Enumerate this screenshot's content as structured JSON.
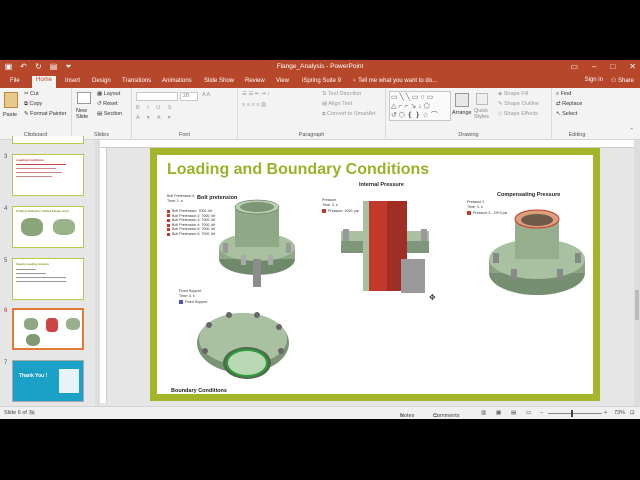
{
  "window": {
    "title": "Flange_Analysis - PowerPoint",
    "controls": [
      "–",
      "□",
      "✕"
    ]
  },
  "tabs": [
    "File",
    "Home",
    "Insert",
    "Design",
    "Transitions",
    "Animations",
    "Slide Show",
    "Review",
    "View",
    "iSpring Suite 9"
  ],
  "tell_me": "Tell me what you want to do...",
  "signin": "Sign in",
  "share": "Share",
  "ribbon": {
    "clipboard": {
      "paste": "Paste",
      "cut": "Cut",
      "copy": "Copy",
      "format_painter": "Format Painter",
      "label": "Clipboard"
    },
    "slides": {
      "new_slide": "New Slide",
      "layout": "Layout",
      "reset": "Reset",
      "section": "Section",
      "label": "Slides"
    },
    "font": {
      "label": "Font",
      "size": "28"
    },
    "paragraph": {
      "text_direction": "Text Direction",
      "align_text": "Align Text",
      "convert_smartart": "Convert to SmartArt",
      "label": "Paragraph"
    },
    "drawing": {
      "arrange": "Arrange",
      "quick_styles": "Quick Styles",
      "shape_fill": "Shape Fill",
      "shape_outline": "Shape Outline",
      "shape_effects": "Shape Effects",
      "label": "Drawing"
    },
    "editing": {
      "find": "Find",
      "replace": "Replace",
      "select": "Select",
      "label": "Editing"
    }
  },
  "thumbnails": [
    {
      "num": "3",
      "text": "Loading Conditions"
    },
    {
      "num": "4",
      "text": "Problem Definition: Bolted Flange Joint"
    },
    {
      "num": "5",
      "text": "Steady Loading Analysis"
    },
    {
      "num": "6",
      "text": ""
    },
    {
      "num": "7",
      "text": "Thank You !"
    }
  ],
  "slide": {
    "title": "Loading and Boundary Conditions",
    "bolt_pretension": {
      "heading": "Bolt pretension",
      "caption1": "Bolt Pretension 6",
      "caption2": "Time: 1. s",
      "items": [
        "Bolt Pretension: 7000. lbf",
        "Bolt Pretension 2: 7000. lbf",
        "Bolt Pretension 3: 7000. lbf",
        "Bolt Pretension 4: 7000. lbf",
        "Bolt Pretension 5: 7000. lbf",
        "Bolt Pretension 6: 7000. lbf"
      ]
    },
    "internal_pressure": {
      "heading": "Internal Pressure",
      "caption1": "Pressure",
      "caption2": "Time: 3. s",
      "item": "Pressure: 1000. psi"
    },
    "compensating_pressure": {
      "heading": "Compensating Pressure",
      "caption1": "Pressure 2",
      "caption2": "Time: 3. s",
      "item": "Pressure 2: -2974 psi"
    },
    "fixed_support": {
      "caption1": "Fixed Support",
      "caption2": "Time: 3. s",
      "item": "Fixed Support"
    },
    "boundary": "Boundary Conditions"
  },
  "status": {
    "slide": "Slide 6 of 7",
    "notes": "Notes",
    "comments": "Comments",
    "zoom": "73%"
  },
  "colors": {
    "accent": "#b7472a",
    "slide_border": "#a4b52a",
    "title": "#9cb02a"
  }
}
